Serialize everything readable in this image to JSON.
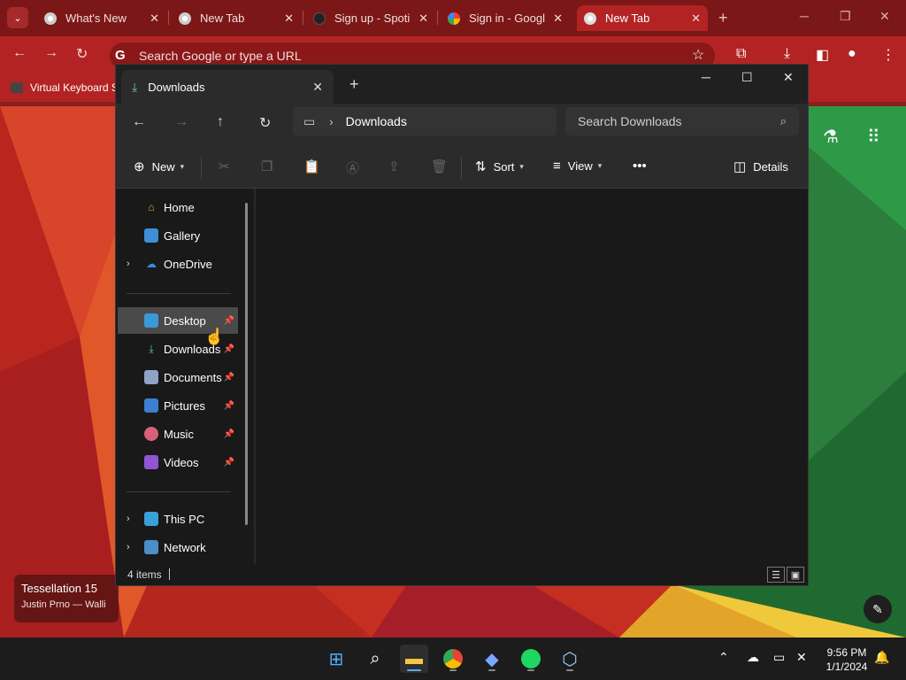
{
  "browser": {
    "tabs": [
      {
        "title": "What's New",
        "active": false
      },
      {
        "title": "New Tab",
        "active": false
      },
      {
        "title": "Sign up - Spoti",
        "active": false
      },
      {
        "title": "Sign in - Googl",
        "active": false
      },
      {
        "title": "New Tab",
        "active": true
      }
    ],
    "omnibox_placeholder": "Search Google or type a URL",
    "bookmark": "Virtual Keyboard S",
    "accent_color": "#b32323"
  },
  "wallpaper": {
    "title": "Tessellation 15",
    "credit": "Justin Prno — Walli"
  },
  "explorer": {
    "tab_title": "Downloads",
    "breadcrumb": "Downloads",
    "search_placeholder": "Search Downloads",
    "commands": {
      "new": "New",
      "sort": "Sort",
      "view": "View",
      "details": "Details"
    },
    "nav": {
      "home": "Home",
      "gallery": "Gallery",
      "onedrive": "OneDrive",
      "desktop": "Desktop",
      "downloads": "Downloads",
      "documents": "Documents",
      "pictures": "Pictures",
      "music": "Music",
      "videos": "Videos",
      "this_pc": "This PC",
      "network": "Network"
    },
    "status": "4 items"
  },
  "taskbar": {
    "time": "9:56 PM",
    "date": "1/1/2024"
  }
}
